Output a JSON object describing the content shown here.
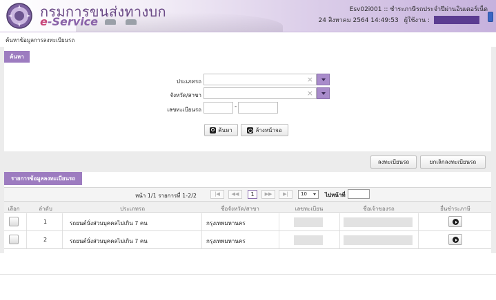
{
  "header": {
    "brand_th": "กรมการขนส่งทางบก",
    "brand_en_prefix": "e",
    "brand_en_rest": "-Service",
    "system_title": "Esv02i001 :: ชำระภาษีรถประจำปีผ่านอินเตอร์เน็ต",
    "datetime": "24 สิงหาคม 2564 14:49:53",
    "user_label": "ผู้ใช้งาน :"
  },
  "breadcrumb": "ค้นหาข้อมูลการลงทะเบียนรถ",
  "search": {
    "tab_label": "ค้นหา",
    "vehicle_type_label": "ประเภทรถ",
    "province_label": "จังหวัด/สาขา",
    "plate_label": "เลขทะเบียนรถ",
    "clear_x": "×",
    "dash": "-",
    "search_button": "ค้นหา",
    "reset_button": "ล้างหน้าจอ"
  },
  "actions": {
    "register_button": "ลงทะเบียนรถ",
    "cancel_register_button": "ยกเลิกลงทะเบียนรถ"
  },
  "list": {
    "tab_label": "รายการข้อมูลลงทะเบียนรถ",
    "pager_text": "หน้า 1/1 รายการที่ 1-2/2",
    "pager_first": "|◀",
    "pager_prev": "◀◀",
    "current_page": "1",
    "pager_next": "▶▶",
    "pager_last": "▶|",
    "page_size": "10",
    "goto_label": "ไปหน้าที่",
    "columns": [
      "เลือก",
      "ลำดับ",
      "ประเภทรถ",
      "ชื่อจังหวัด/สาขา",
      "เลขทะเบียน",
      "ชื่อเจ้าของรถ",
      "ยื่นชำระภาษี"
    ],
    "rows": [
      {
        "index": "1",
        "vehicle_type": "รถยนต์นั่งส่วนบุคคลไม่เกิน 7 คน",
        "province": "กรุงเทพมหานคร"
      },
      {
        "index": "2",
        "vehicle_type": "รถยนต์นั่งส่วนบุคคลไม่เกิน 7 คน",
        "province": "กรุงเทพมหานคร"
      }
    ]
  },
  "colors": {
    "accent_purple": "#9d7cc0",
    "header_gradient_end": "#c6b1dd"
  }
}
